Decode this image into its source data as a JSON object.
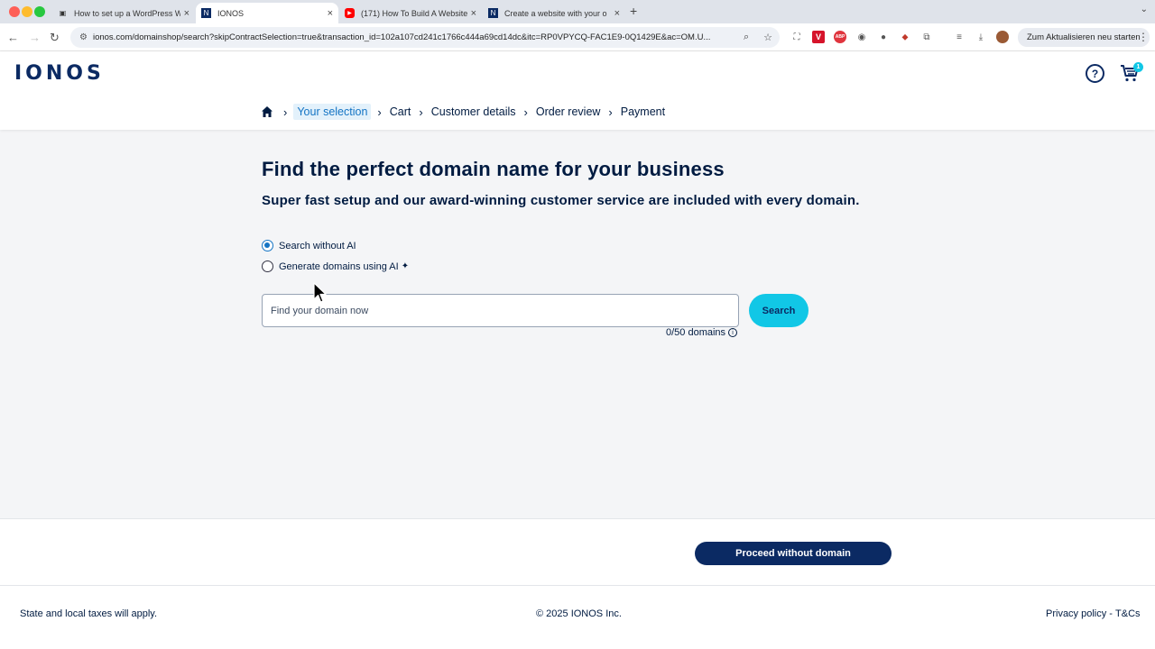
{
  "browser": {
    "tabs": [
      {
        "title": "How to set up a WordPress W",
        "favicon": "notion-icon"
      },
      {
        "title": "IONOS",
        "favicon": "ionos-icon"
      },
      {
        "title": "(171) How To Build A Website",
        "favicon": "youtube-icon"
      },
      {
        "title": "Create a website with your o",
        "favicon": "ionos-icon"
      }
    ],
    "url": "ionos.com/domainshop/search?skipContractSelection=true&transaction_id=102a107cd241c1766c444a69cd14dc&itc=RP0VPYCQ-FAC1E9-0Q1429E&ac=OM.U...",
    "relaunch_label": "Zum Aktualisieren neu starten"
  },
  "site": {
    "logo": "IONOS",
    "cart_count": "1"
  },
  "breadcrumb": {
    "items": [
      "Your selection",
      "Cart",
      "Customer details",
      "Order review",
      "Payment"
    ]
  },
  "main": {
    "title": "Find the perfect domain name for your business",
    "subtitle": "Super fast setup and our award-winning customer service are included with every domain.",
    "radio_options": [
      {
        "label": "Search without AI",
        "checked": true
      },
      {
        "label": "Generate domains using AI",
        "checked": false
      }
    ],
    "search": {
      "placeholder": "Find your domain now",
      "value": "",
      "button_label": "Search",
      "count_label": "0/50 domains"
    }
  },
  "bottom": {
    "proceed_label": "Proceed without domain"
  },
  "footer": {
    "taxes": "State and local taxes will apply.",
    "copyright": "© 2025 IONOS Inc.",
    "privacy": "Privacy policy",
    "separator": " - ",
    "terms": "T&Cs"
  },
  "colors": {
    "brand_navy": "#0b2a63",
    "accent_cyan": "#11c7e6",
    "link_blue": "#1474c4"
  }
}
